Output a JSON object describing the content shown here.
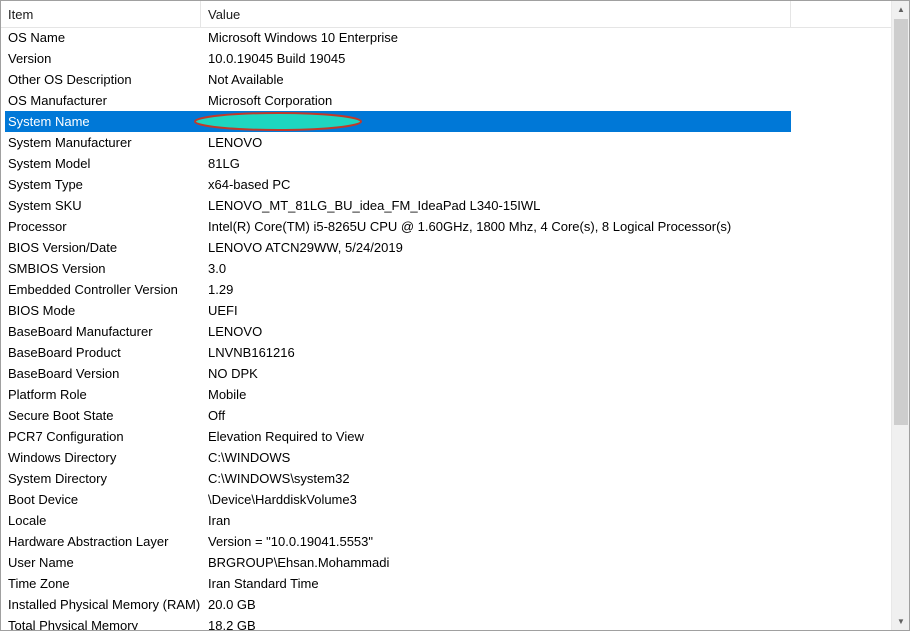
{
  "columns": {
    "item": "Item",
    "value": "Value"
  },
  "selected_row_index": 4,
  "rows": [
    {
      "item": "OS Name",
      "value": "Microsoft Windows 10 Enterprise"
    },
    {
      "item": "Version",
      "value": "10.0.19045 Build 19045"
    },
    {
      "item": "Other OS Description",
      "value": "Not Available"
    },
    {
      "item": "OS Manufacturer",
      "value": "Microsoft Corporation"
    },
    {
      "item": "System Name",
      "value": ""
    },
    {
      "item": "System Manufacturer",
      "value": "LENOVO"
    },
    {
      "item": "System Model",
      "value": "81LG"
    },
    {
      "item": "System Type",
      "value": "x64-based PC"
    },
    {
      "item": "System SKU",
      "value": "LENOVO_MT_81LG_BU_idea_FM_IdeaPad L340-15IWL"
    },
    {
      "item": "Processor",
      "value": "Intel(R) Core(TM) i5-8265U CPU @ 1.60GHz, 1800 Mhz, 4 Core(s), 8 Logical Processor(s)"
    },
    {
      "item": "BIOS Version/Date",
      "value": "LENOVO ATCN29WW, 5/24/2019"
    },
    {
      "item": "SMBIOS Version",
      "value": "3.0"
    },
    {
      "item": "Embedded Controller Version",
      "value": "1.29"
    },
    {
      "item": "BIOS Mode",
      "value": "UEFI"
    },
    {
      "item": "BaseBoard Manufacturer",
      "value": "LENOVO"
    },
    {
      "item": "BaseBoard Product",
      "value": "LNVNB161216"
    },
    {
      "item": "BaseBoard Version",
      "value": "NO DPK"
    },
    {
      "item": "Platform Role",
      "value": "Mobile"
    },
    {
      "item": "Secure Boot State",
      "value": "Off"
    },
    {
      "item": "PCR7 Configuration",
      "value": "Elevation Required to View"
    },
    {
      "item": "Windows Directory",
      "value": "C:\\WINDOWS"
    },
    {
      "item": "System Directory",
      "value": "C:\\WINDOWS\\system32"
    },
    {
      "item": "Boot Device",
      "value": "\\Device\\HarddiskVolume3"
    },
    {
      "item": "Locale",
      "value": "Iran"
    },
    {
      "item": "Hardware Abstraction Layer",
      "value": "Version = \"10.0.19041.5553\""
    },
    {
      "item": "User Name",
      "value": "BRGROUP\\Ehsan.Mohammadi"
    },
    {
      "item": "Time Zone",
      "value": "Iran Standard Time"
    },
    {
      "item": "Installed Physical Memory (RAM)",
      "value": "20.0 GB"
    },
    {
      "item": "Total Physical Memory",
      "value": "18.2 GB"
    }
  ],
  "colors": {
    "selection": "#0078d7",
    "redaction_fill": "#1ed6c0",
    "redaction_outline": "#c0392b"
  },
  "icons": {
    "scroll_up": "triangle-up-icon",
    "scroll_down": "triangle-down-icon"
  }
}
